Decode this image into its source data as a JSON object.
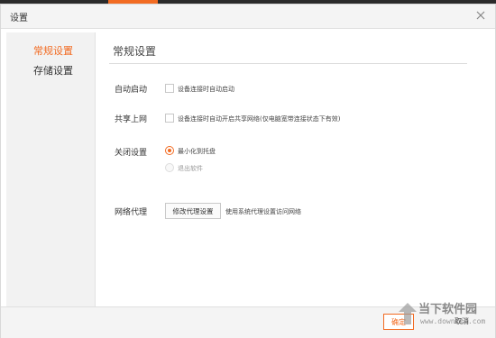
{
  "window": {
    "title": "设置"
  },
  "colors": {
    "accent": "#f26b22",
    "sidebar_bg": "#f2f2f2",
    "titlebar_bg": "#f4f4f4"
  },
  "sidebar": {
    "items": [
      {
        "label": "常规设置",
        "active": true
      },
      {
        "label": "存储设置",
        "active": false
      }
    ]
  },
  "main": {
    "section_title": "常规设置",
    "autostart": {
      "label": "自动启动",
      "option_text": "设备连接时自动启动",
      "checked": false
    },
    "share": {
      "label": "共享上网",
      "option_text": "设备连接时自动开启共享网络(仅电脑宽带连接状态下有效)",
      "checked": false
    },
    "close": {
      "label": "关闭设置",
      "options": [
        {
          "text": "最小化到托盘",
          "selected": true
        },
        {
          "text": "退出软件",
          "selected": false
        }
      ]
    },
    "proxy": {
      "label": "网络代理",
      "button_label": "修改代理设置",
      "hint": "使用系统代理设置访问网络"
    }
  },
  "footer": {
    "ok_label": "确定",
    "cancel_label": "取消"
  },
  "watermark": {
    "text_cn": "当下软件园",
    "text_en": "www.downxia.com"
  },
  "icons": {
    "close": "close-icon",
    "watermark_logo": "download-logo-icon"
  }
}
